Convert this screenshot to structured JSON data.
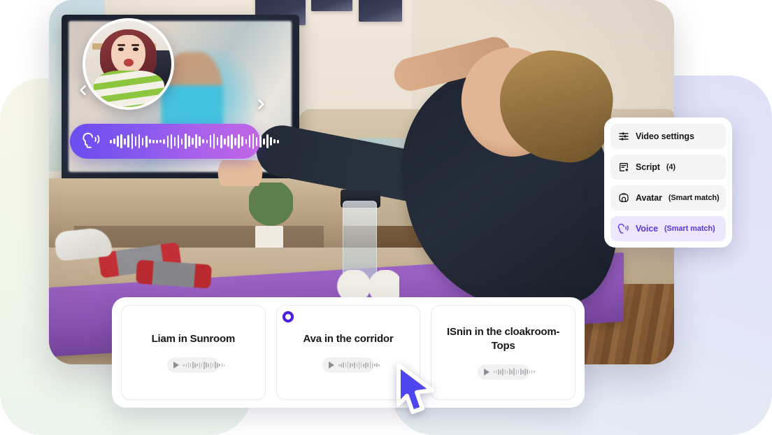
{
  "theme": {
    "accent_purple": "#4b1fe0",
    "accent_voice": "#5b34e0",
    "voice_pill_gradient_start": "#6a4df0",
    "voice_pill_gradient_end": "#c266e6",
    "cursor_color": "#4f46f0",
    "menu_active_bg": "#ece7fe",
    "menu_item_bg": "#f4f4f5",
    "bg_blob_left": "#f5f6e9",
    "bg_blob_right": "#dfe0f7"
  },
  "video_preview": {
    "avatar": {
      "icon": "avatar-bubble",
      "description": "presenter circular video bubble"
    },
    "nav": {
      "prev_icon": "chevron-left-icon",
      "next_icon": "chevron-right-icon"
    },
    "voice_pill": {
      "icon": "speaking-head-icon",
      "waveform_bars": [
        5,
        8,
        16,
        20,
        9,
        18,
        22,
        14,
        20,
        11,
        17,
        6,
        5,
        5,
        4,
        7,
        17,
        21,
        13,
        19,
        9,
        22,
        16,
        10,
        20,
        14,
        6,
        5,
        18,
        22,
        12,
        19,
        9,
        16,
        21,
        11,
        20,
        14,
        7,
        18,
        22,
        13,
        17,
        9,
        20,
        12,
        6,
        5
      ]
    }
  },
  "settings_menu": {
    "items": [
      {
        "icon": "sliders-icon",
        "label": "Video settings",
        "sub": "",
        "active": false
      },
      {
        "icon": "script-icon",
        "label": "Script",
        "sub": "(4)",
        "active": false
      },
      {
        "icon": "avatar-icon",
        "label": "Avatar",
        "sub": "(Smart match)",
        "active": false
      },
      {
        "icon": "speaking-head-icon",
        "label": "Voice",
        "sub": "(Smart match)",
        "active": true
      }
    ]
  },
  "voice_panel": {
    "cards": [
      {
        "title": "Liam in Sunroom",
        "selected": false,
        "player": {
          "play_icon": "play-icon",
          "wave_bars": [
            3,
            5,
            8,
            6,
            10,
            7,
            4,
            9,
            6,
            11,
            8,
            5,
            9,
            6,
            10,
            7,
            4,
            6,
            3
          ]
        }
      },
      {
        "title": "Ava in the corridor",
        "selected": true,
        "player": {
          "play_icon": "play-icon",
          "wave_bars": [
            3,
            5,
            8,
            6,
            10,
            7,
            4,
            9,
            6,
            11,
            8,
            5,
            9,
            6,
            10,
            7,
            4,
            6,
            3
          ]
        }
      },
      {
        "title": "ISnin in the cloakroom-Tops",
        "selected": false,
        "player": {
          "play_icon": "play-icon",
          "wave_bars": [
            3,
            5,
            8,
            6,
            10,
            7,
            4,
            9,
            6,
            11,
            8,
            5,
            9,
            6,
            10,
            7,
            4,
            6,
            3
          ]
        }
      }
    ]
  },
  "cursor": {
    "icon": "mouse-cursor-icon"
  }
}
